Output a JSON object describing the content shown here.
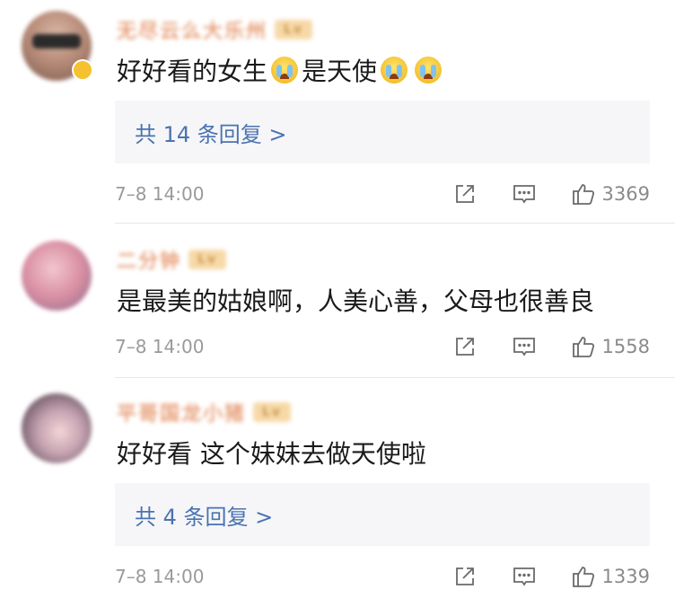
{
  "comments": [
    {
      "username": "无尽云么大乐州",
      "badge": "Lv",
      "text_parts": [
        "好好看的女生",
        "是天使",
        ""
      ],
      "emoji_name": "crying-face-icon",
      "reply_label": "共 14 条回复 >",
      "time": "7–8 14:00",
      "likes": "3369"
    },
    {
      "username": "二分钟",
      "badge": "Lv",
      "text": "是最美的姑娘啊，人美心善，父母也很善良",
      "time": "7–8 14:00",
      "likes": "1558"
    },
    {
      "username": "平哥国龙小猪",
      "badge": "Lv",
      "text": "好好看 这个妹妹去做天使啦",
      "reply_label": "共 4 条回复 >",
      "time": "7–8 14:00",
      "likes": "1339"
    }
  ],
  "colors": {
    "reply_link": "#4a73b0",
    "username": "#e8a07a",
    "reply_bg": "#f6f6f8"
  }
}
